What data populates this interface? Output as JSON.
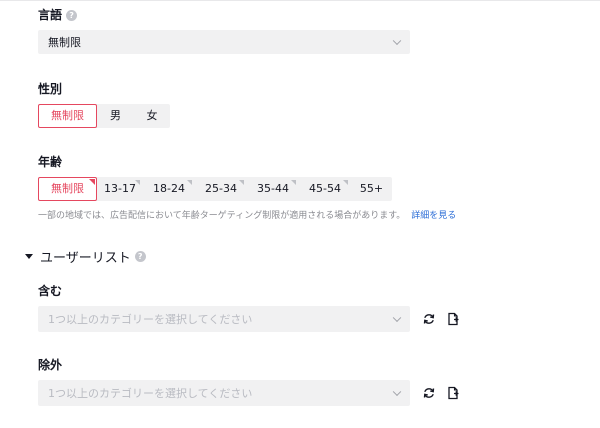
{
  "language": {
    "label": "言語",
    "help_icon": "?",
    "value": "無制限"
  },
  "gender": {
    "label": "性別",
    "options": [
      "無制限",
      "男",
      "女"
    ],
    "selected": "無制限"
  },
  "age": {
    "label": "年齢",
    "options": [
      "無制限",
      "13-17",
      "18-24",
      "25-34",
      "35-44",
      "45-54",
      "55+"
    ],
    "selected": "無制限",
    "note": "一部の地域では、広告配信において年齢ターゲティング制限が適用される場合があります。",
    "note_link": "詳細を見る"
  },
  "user_list": {
    "title": "ユーザーリスト",
    "help_icon": "?",
    "include": {
      "label": "含む",
      "placeholder": "1つ以上のカテゴリーを選択してください"
    },
    "exclude": {
      "label": "除外",
      "placeholder": "1つ以上のカテゴリーを選択してください"
    }
  },
  "icons": {
    "refresh": "refresh-icon",
    "edit": "edit-file-icon"
  },
  "colors": {
    "accent": "#e5475f",
    "link": "#2a6cd6",
    "field_bg": "#f1f1f2"
  }
}
